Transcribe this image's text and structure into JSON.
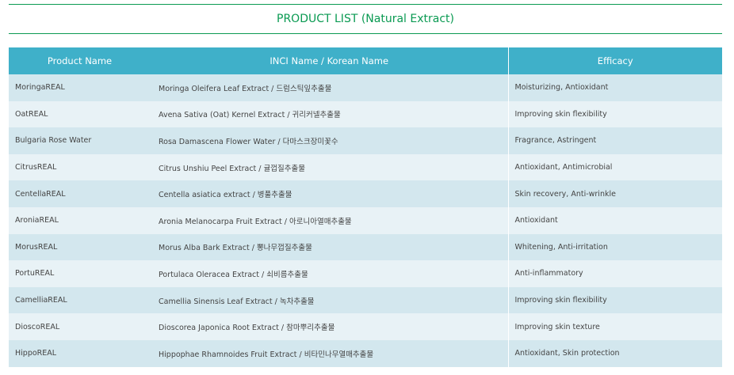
{
  "page": {
    "title": "PRODUCT LIST (Natural Extract)"
  },
  "table": {
    "headers": {
      "product_name": "Product Name",
      "inci_name": "INCI Name / Korean Name",
      "efficacy": "Efficacy"
    },
    "rows": [
      {
        "product": "MoringaREAL",
        "inci": "Moringa Oleifera Leaf Extract / 드럼스틱잎추출물",
        "efficacy": "Moisturizing, Antioxidant"
      },
      {
        "product": "OatREAL",
        "inci": "Avena Sativa (Oat) Kernel Extract / 귀리커넬추출물",
        "efficacy": "Improving skin flexibility"
      },
      {
        "product": "Bulgaria Rose Water",
        "inci": "Rosa Damascena Flower Water / 다마스크장미꽃수",
        "efficacy": "Fragrance, Astringent"
      },
      {
        "product": "CitrusREAL",
        "inci": "Citrus Unshiu Peel Extract / 귤껍질추출물",
        "efficacy": "Antioxidant, Antimicrobial"
      },
      {
        "product": "CentellaREAL",
        "inci": "Centella asiatica extract / 병풀추출물",
        "efficacy": "Skin recovery, Anti-wrinkle"
      },
      {
        "product": "AroniaREAL",
        "inci": "Aronia Melanocarpa Fruit Extract / 아로니아열매추출물",
        "efficacy": "Antioxidant"
      },
      {
        "product": "MorusREAL",
        "inci": "Morus Alba Bark Extract / 뽕나무껍질추출물",
        "efficacy": "Whitening, Anti-irritation"
      },
      {
        "product": "PortuREAL",
        "inci": "Portulaca Oleracea Extract / 쇠비름추출물",
        "efficacy": "Anti-inflammatory"
      },
      {
        "product": "CamelliaREAL",
        "inci": "Camellia Sinensis Leaf Extract / 녹차추출물",
        "efficacy": "Improving skin flexibility"
      },
      {
        "product": "DioscoREAL",
        "inci": "Dioscorea Japonica Root Extract / 참마뿌리추출물",
        "efficacy": "Improving skin texture"
      },
      {
        "product": "HippoREAL",
        "inci": "Hippophae Rhamnoides Fruit Extract / 비타민나무열매추출물",
        "efficacy": "Antioxidant, Skin protection"
      }
    ]
  },
  "colors": {
    "accent_green": "#0a9a52",
    "header_teal": "#3fb0c9",
    "row_odd": "#d3e7ee",
    "row_even": "#e8f2f6"
  }
}
